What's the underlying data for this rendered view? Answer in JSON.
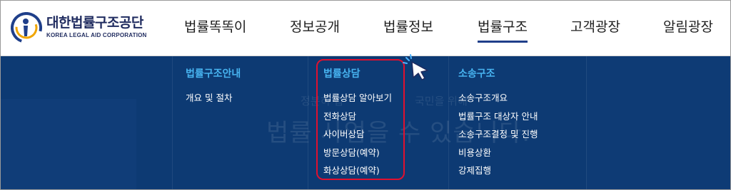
{
  "brand": {
    "name_kr": "대한법률구조공단",
    "name_en": "KOREA LEGAL AID CORPORATION"
  },
  "nav": {
    "items": [
      {
        "label": "법률똑똑이"
      },
      {
        "label": "정보공개"
      },
      {
        "label": "법률정보"
      },
      {
        "label": "법률구조"
      },
      {
        "label": "고객광장"
      },
      {
        "label": "알림광장"
      }
    ],
    "active": "법률구조"
  },
  "submenu": {
    "columns": [
      {
        "title": "법률구조안내",
        "items": [
          "개요 및 절차"
        ]
      },
      {
        "title": "법률상담",
        "items": [
          "법률상담 알아보기",
          "전화상담",
          "사이버상담",
          "방문상담(예약)",
          "화상상담(예약)"
        ]
      },
      {
        "title": "소송구조",
        "items": [
          "소송구조개요",
          "법률구조 대상자 안내",
          "소송구조결정 및 진행",
          "비용상환",
          "강제집행"
        ]
      }
    ]
  },
  "background_text": {
    "line1": "정분히 법",
    "line1b": "국민을 위해",
    "line2": "법률  사업을 수    있습니다."
  },
  "colors": {
    "panel_bg": "#0d3a73",
    "column_title": "#47b3f0",
    "highlight": "#e0102f",
    "active_underline": "#1f3f8a"
  }
}
